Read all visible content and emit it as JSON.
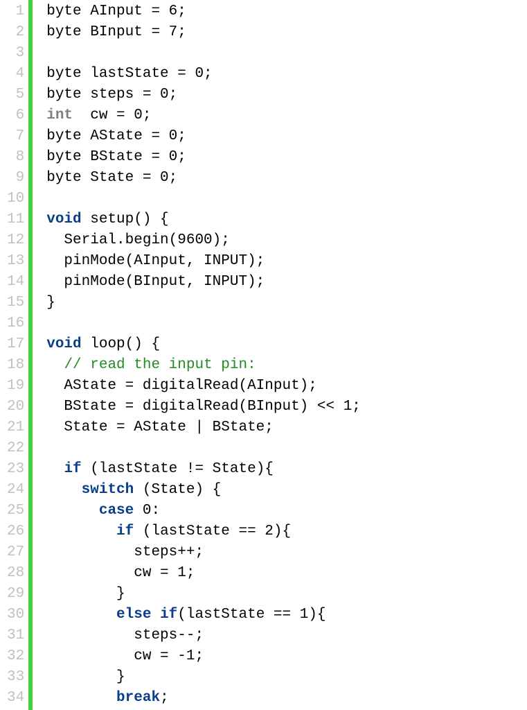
{
  "lines": [
    {
      "n": 1,
      "segs": [
        {
          "t": "byte AInput = 6;"
        }
      ]
    },
    {
      "n": 2,
      "segs": [
        {
          "t": "byte BInput = 7;"
        }
      ]
    },
    {
      "n": 3,
      "segs": [
        {
          "t": ""
        }
      ]
    },
    {
      "n": 4,
      "segs": [
        {
          "t": "byte lastState = 0;"
        }
      ]
    },
    {
      "n": 5,
      "segs": [
        {
          "t": "byte steps = 0;"
        }
      ]
    },
    {
      "n": 6,
      "segs": [
        {
          "t": "int",
          "c": "kw-type"
        },
        {
          "t": "  cw = 0;"
        }
      ]
    },
    {
      "n": 7,
      "segs": [
        {
          "t": "byte AState = 0;"
        }
      ]
    },
    {
      "n": 8,
      "segs": [
        {
          "t": "byte BState = 0;"
        }
      ]
    },
    {
      "n": 9,
      "segs": [
        {
          "t": "byte State = 0;"
        }
      ]
    },
    {
      "n": 10,
      "segs": [
        {
          "t": ""
        }
      ]
    },
    {
      "n": 11,
      "segs": [
        {
          "t": "void",
          "c": "kw"
        },
        {
          "t": " setup() {"
        }
      ]
    },
    {
      "n": 12,
      "segs": [
        {
          "t": "  Serial.begin(9600);"
        }
      ]
    },
    {
      "n": 13,
      "segs": [
        {
          "t": "  pinMode(AInput, INPUT);"
        }
      ]
    },
    {
      "n": 14,
      "segs": [
        {
          "t": "  pinMode(BInput, INPUT);"
        }
      ]
    },
    {
      "n": 15,
      "segs": [
        {
          "t": "}"
        }
      ]
    },
    {
      "n": 16,
      "segs": [
        {
          "t": ""
        }
      ]
    },
    {
      "n": 17,
      "segs": [
        {
          "t": "void",
          "c": "kw"
        },
        {
          "t": " loop() {"
        }
      ]
    },
    {
      "n": 18,
      "segs": [
        {
          "t": "  "
        },
        {
          "t": "// read the input pin:",
          "c": "comment"
        }
      ]
    },
    {
      "n": 19,
      "segs": [
        {
          "t": "  AState = digitalRead(AInput);"
        }
      ]
    },
    {
      "n": 20,
      "segs": [
        {
          "t": "  BState = digitalRead(BInput) << 1;"
        }
      ]
    },
    {
      "n": 21,
      "segs": [
        {
          "t": "  State = AState | BState;"
        }
      ]
    },
    {
      "n": 22,
      "segs": [
        {
          "t": ""
        }
      ]
    },
    {
      "n": 23,
      "segs": [
        {
          "t": "  "
        },
        {
          "t": "if",
          "c": "kw"
        },
        {
          "t": " (lastState != State){"
        }
      ]
    },
    {
      "n": 24,
      "segs": [
        {
          "t": "    "
        },
        {
          "t": "switch",
          "c": "kw"
        },
        {
          "t": " (State) {"
        }
      ]
    },
    {
      "n": 25,
      "segs": [
        {
          "t": "      "
        },
        {
          "t": "case",
          "c": "kw"
        },
        {
          "t": " 0:"
        }
      ]
    },
    {
      "n": 26,
      "segs": [
        {
          "t": "        "
        },
        {
          "t": "if",
          "c": "kw"
        },
        {
          "t": " (lastState == 2){"
        }
      ]
    },
    {
      "n": 27,
      "segs": [
        {
          "t": "          steps++;"
        }
      ]
    },
    {
      "n": 28,
      "segs": [
        {
          "t": "          cw = 1;"
        }
      ]
    },
    {
      "n": 29,
      "segs": [
        {
          "t": "        }"
        }
      ]
    },
    {
      "n": 30,
      "segs": [
        {
          "t": "        "
        },
        {
          "t": "else",
          "c": "kw"
        },
        {
          "t": " "
        },
        {
          "t": "if",
          "c": "kw"
        },
        {
          "t": "(lastState == 1){"
        }
      ]
    },
    {
      "n": 31,
      "segs": [
        {
          "t": "          steps--;"
        }
      ]
    },
    {
      "n": 32,
      "segs": [
        {
          "t": "          cw = -1;"
        }
      ]
    },
    {
      "n": 33,
      "segs": [
        {
          "t": "        }"
        }
      ]
    },
    {
      "n": 34,
      "segs": [
        {
          "t": "        "
        },
        {
          "t": "break",
          "c": "kw"
        },
        {
          "t": ";"
        }
      ]
    }
  ]
}
